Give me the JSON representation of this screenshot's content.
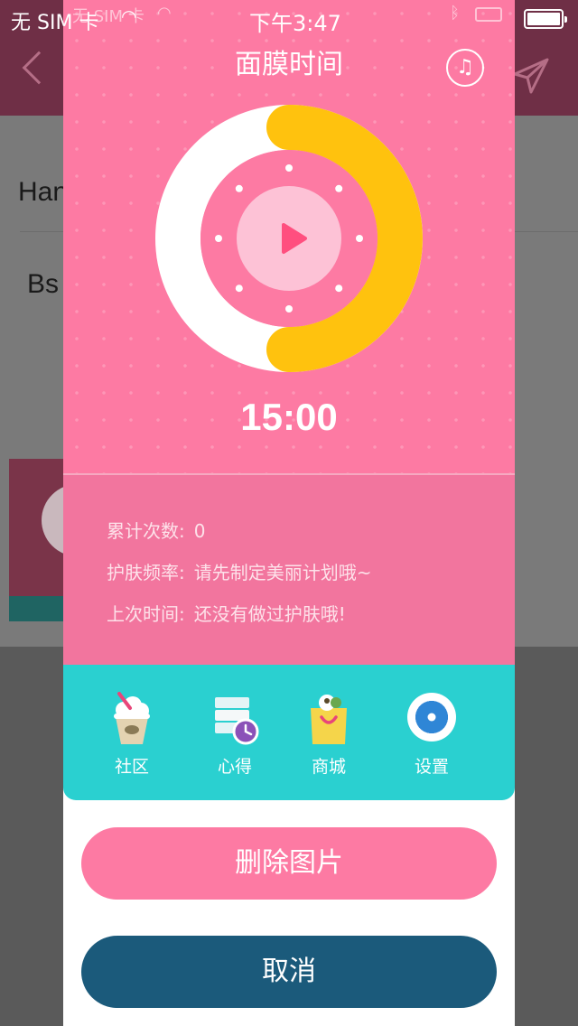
{
  "status_bar": {
    "carrier": "无 SIM 卡",
    "carrier_ghost": "无 SIM 卡",
    "time": "下午3:47"
  },
  "background": {
    "row_1": "Han",
    "row_2": "Bs"
  },
  "sheet": {
    "title": "面膜时间",
    "timer": "15:00",
    "ring_progress": 0.5,
    "stats": [
      {
        "label": "累计次数:",
        "value": "0"
      },
      {
        "label": "护肤频率:",
        "value": "请先制定美丽计划哦~"
      },
      {
        "label": "上次时间:",
        "value": "还没有做过护肤哦!"
      }
    ],
    "tabs": [
      {
        "label": "社区",
        "icon": "ice-cream-icon"
      },
      {
        "label": "心得",
        "icon": "notes-clock-icon"
      },
      {
        "label": "商城",
        "icon": "shopping-bag-icon"
      },
      {
        "label": "设置",
        "icon": "gear-icon"
      }
    ]
  },
  "actions": {
    "delete_label": "删除图片",
    "cancel_label": "取消"
  },
  "colors": {
    "pink": "#fd7aa3",
    "stats_pink": "#f2759e",
    "teal": "#2ad0d0",
    "ring_yellow": "#ffc20e",
    "cancel_navy": "#1b5a7b"
  }
}
